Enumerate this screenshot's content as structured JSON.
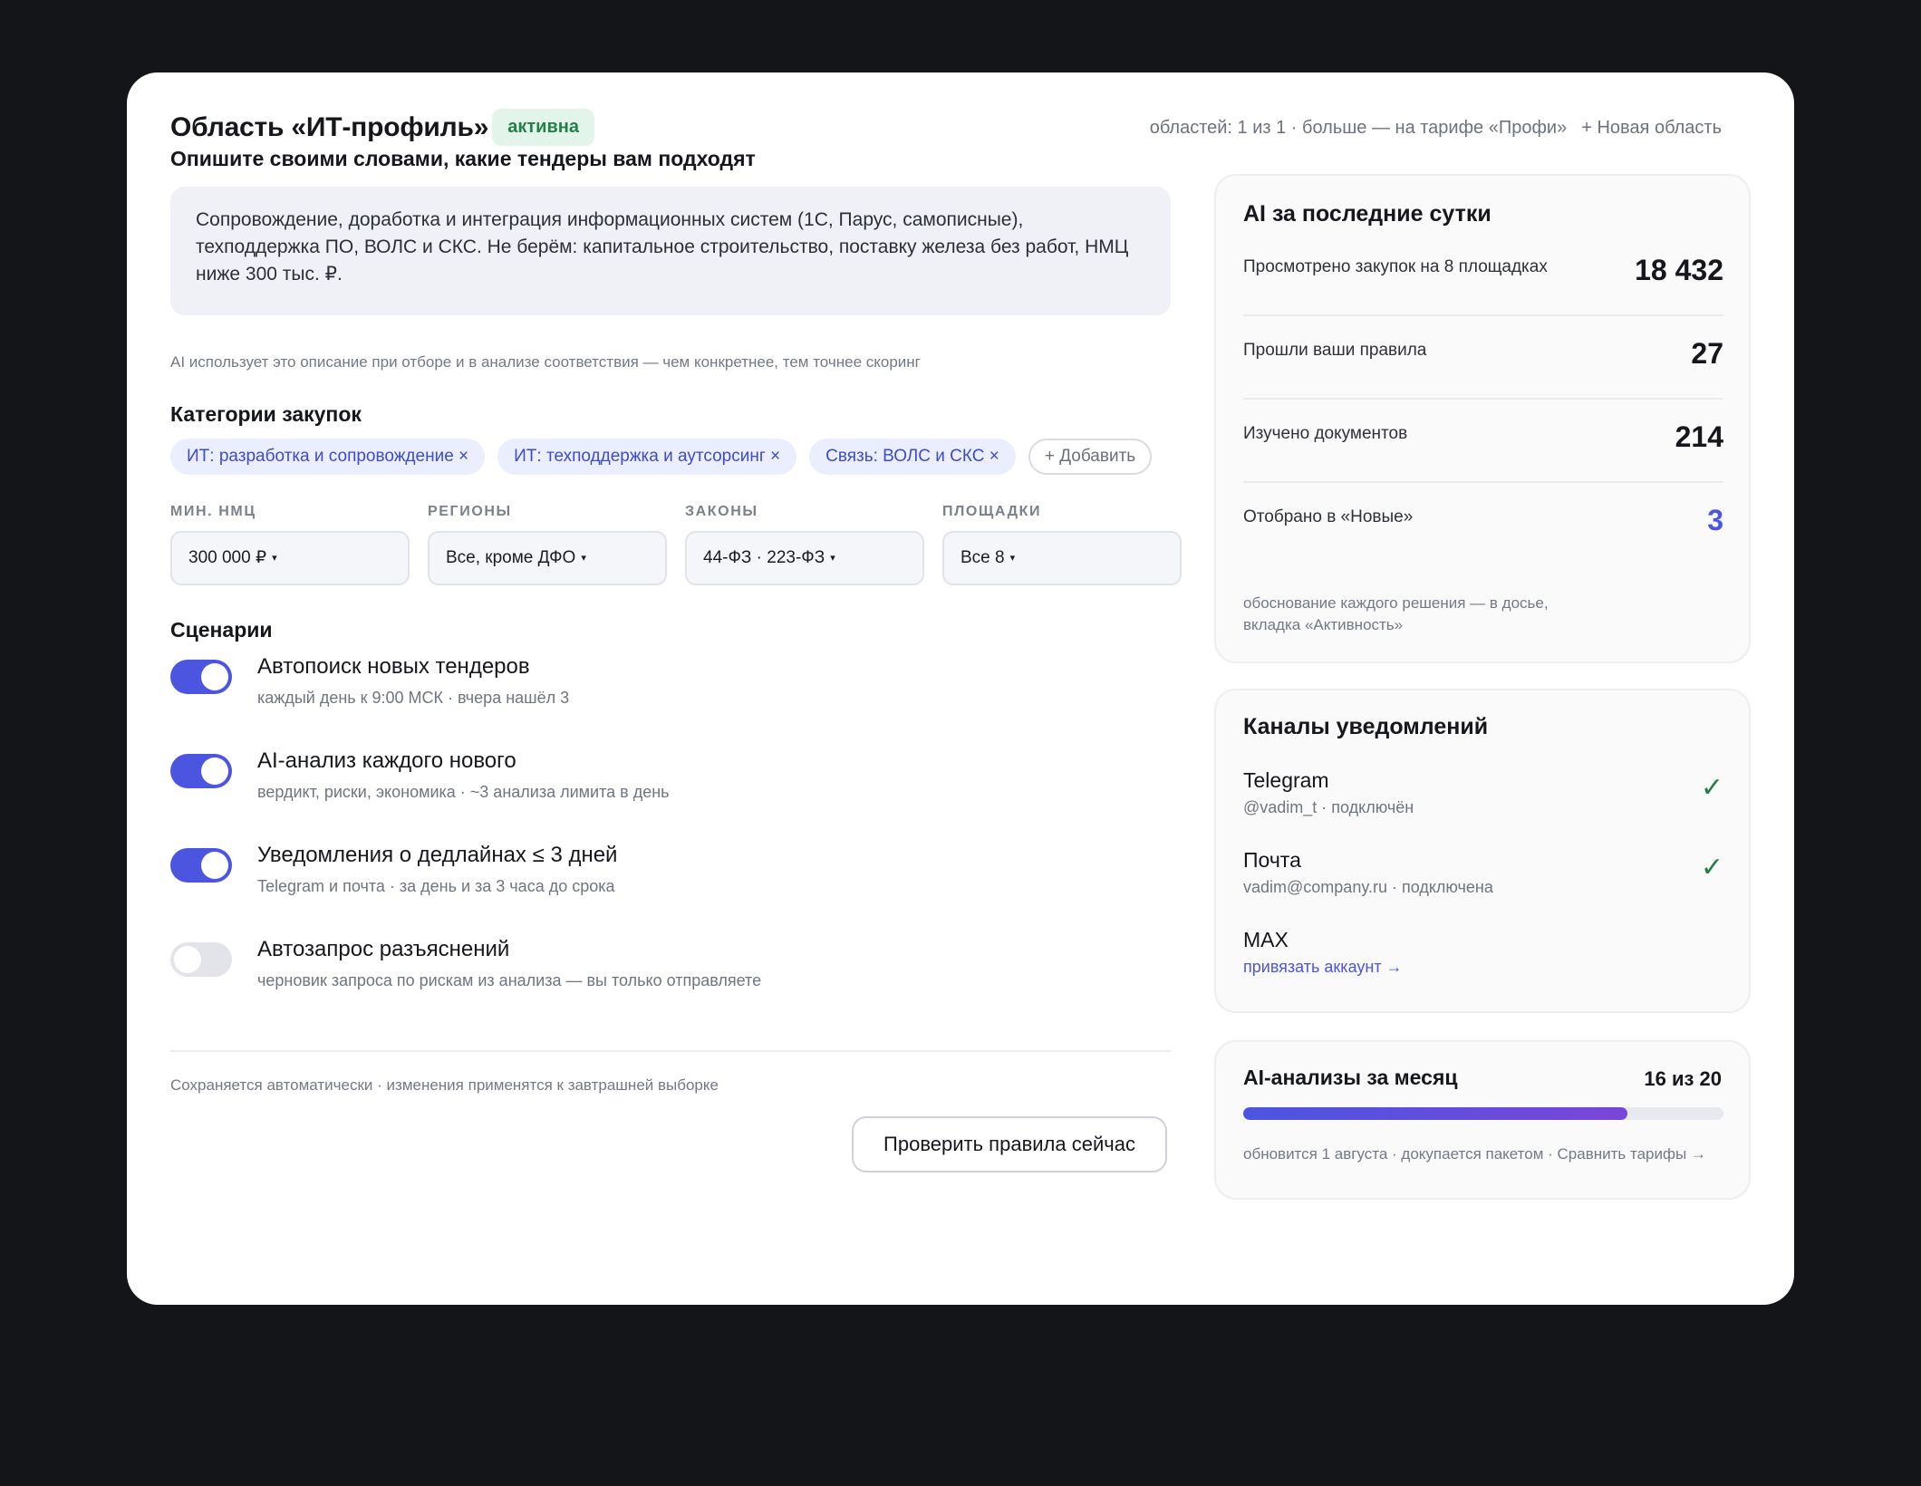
{
  "header": {
    "title": "Область «ИТ-профиль»",
    "status": "активна",
    "areas_info": "областей: 1 из 1 · больше — на тарифе «Профи»",
    "new_area": "+ Новая область"
  },
  "description": {
    "label": "Опишите своими словами, какие тендеры вам подходят",
    "text": "Сопровождение, доработка и интеграция информационных систем (1С, Парус, самописные), техподдержка ПО, ВОЛС и СКС. Не берём: капитальное строительство, поставку железа без работ, НМЦ ниже 300 тыс. ₽.",
    "hint": "AI использует это описание при отборе и в анализе соответствия — чем конкретнее, тем точнее скоринг"
  },
  "categories": {
    "label": "Категории закупок",
    "items": [
      "ИТ: разработка и сопровождение ×",
      "ИТ: техподдержка и аутсорсинг ×",
      "Связь: ВОЛС и СКС ×"
    ],
    "add_label": "+ Добавить"
  },
  "filters": [
    {
      "label": "МИН. НМЦ",
      "value": "300 000 ₽"
    },
    {
      "label": "РЕГИОНЫ",
      "value": "Все, кроме ДФО"
    },
    {
      "label": "ЗАКОНЫ",
      "value": "44-ФЗ · 223-ФЗ"
    },
    {
      "label": "ПЛОЩАДКИ",
      "value": "Все 8"
    }
  ],
  "caret": "▾",
  "scenarios": {
    "label": "Сценарии",
    "items": [
      {
        "title": "Автопоиск новых тендеров",
        "sub": "каждый день к 9:00 МСК · вчера нашёл 3",
        "enabled": true
      },
      {
        "title": "AI-анализ каждого нового",
        "sub": "вердикт, риски, экономика · ~3 анализа лимита в день",
        "enabled": true
      },
      {
        "title": "Уведомления о дедлайнах ≤ 3 дней",
        "sub": "Telegram и почта · за день и за 3 часа до срока",
        "enabled": true
      },
      {
        "title": "Автозапрос разъяснений",
        "sub": "черновик запроса по рискам из анализа — вы только отправляете",
        "enabled": false
      }
    ]
  },
  "footer": {
    "autosave": "Сохраняется автоматически · изменения применятся к завтрашней выборке",
    "check_button": "Проверить правила сейчас"
  },
  "stats": {
    "title": "AI за последние сутки",
    "rows": [
      {
        "label": "Просмотрено закупок на 8 площадках",
        "value": "18 432"
      },
      {
        "label": "Прошли ваши правила",
        "value": "27"
      },
      {
        "label": "Изучено документов",
        "value": "214"
      },
      {
        "label": "Отобрано в «Новые»",
        "value": "3"
      }
    ],
    "note_line1": "обоснование каждого решения — в досье,",
    "note_line2": "вкладка «Активность»"
  },
  "channels": {
    "title": "Каналы уведомлений",
    "items": [
      {
        "name": "Telegram",
        "sub": "@vadim_t · подключён",
        "connected": true
      },
      {
        "name": "Почта",
        "sub": "vadim@company.ru · подключена",
        "connected": true
      },
      {
        "name": "MAX",
        "sub": "привязать аккаунт →",
        "connected": false
      }
    ],
    "check_glyph": "✓"
  },
  "usage": {
    "title": "AI-анализы за месяц",
    "count": "16 из 20",
    "used": 16,
    "limit": 20,
    "note": "обновится 1 августа · докупается пакетом · Сравнить тарифы →"
  },
  "colors": {
    "accent": "#4b55e0",
    "success": "#23804a",
    "background": "#141518"
  }
}
